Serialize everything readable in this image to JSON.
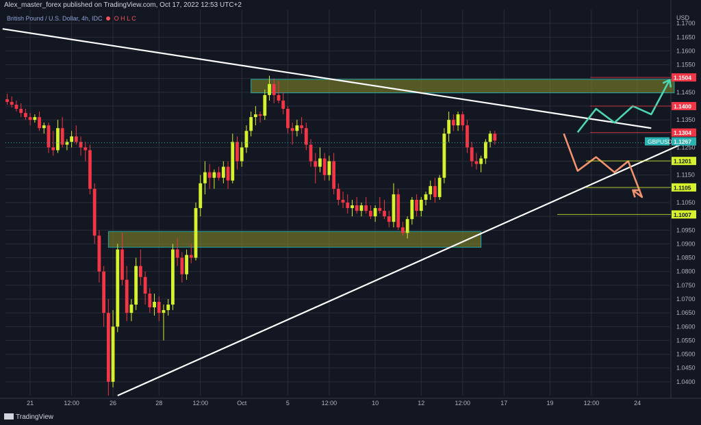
{
  "header": {
    "credit": "Alex_master_forex published on TradingView.com, Oct 17, 2022 12:53 UTC+2",
    "symbol": "British Pound / U.S. Dollar, 4h, IDC",
    "ohlc_hint": "O  H  L  C"
  },
  "footer": {
    "brand": "TradingView"
  },
  "chart_data": {
    "type": "candlestick",
    "symbol": "GBPUSD",
    "timeframe": "4h",
    "currency": "USD",
    "y_range": [
      1.035,
      1.175
    ],
    "y_ticks": [
      1.04,
      1.045,
      1.05,
      1.055,
      1.06,
      1.065,
      1.07,
      1.075,
      1.08,
      1.085,
      1.09,
      1.095,
      1.1,
      1.105,
      1.11,
      1.115,
      1.12,
      1.125,
      1.13,
      1.135,
      1.14,
      1.145,
      1.15,
      1.155,
      1.16,
      1.165,
      1.17
    ],
    "x_ticks": [
      {
        "label": "21",
        "bar": 5
      },
      {
        "label": "12:00",
        "bar": 14
      },
      {
        "label": "26",
        "bar": 23
      },
      {
        "label": "28",
        "bar": 33
      },
      {
        "label": "12:00",
        "bar": 42
      },
      {
        "label": "Oct",
        "bar": 51
      },
      {
        "label": "5",
        "bar": 61
      },
      {
        "label": "12:00",
        "bar": 70
      },
      {
        "label": "10",
        "bar": 80
      },
      {
        "label": "12",
        "bar": 90
      },
      {
        "label": "12:00",
        "bar": 99
      },
      {
        "label": "17",
        "bar": 108
      },
      {
        "label": "19",
        "bar": 118
      },
      {
        "label": "12:00",
        "bar": 127
      },
      {
        "label": "24",
        "bar": 137
      }
    ],
    "candles": [
      [
        1.1425,
        1.1445,
        1.1405,
        1.1415
      ],
      [
        1.1415,
        1.1435,
        1.1395,
        1.1405
      ],
      [
        1.1405,
        1.142,
        1.138,
        1.139
      ],
      [
        1.139,
        1.141,
        1.136,
        1.1375
      ],
      [
        1.1375,
        1.139,
        1.135,
        1.136
      ],
      [
        1.136,
        1.1375,
        1.133,
        1.135
      ],
      [
        1.135,
        1.137,
        1.134,
        1.136
      ],
      [
        1.136,
        1.138,
        1.131,
        1.132
      ],
      [
        1.132,
        1.134,
        1.13,
        1.133
      ],
      [
        1.133,
        1.134,
        1.123,
        1.125
      ],
      [
        1.125,
        1.131,
        1.122,
        1.124
      ],
      [
        1.124,
        1.135,
        1.123,
        1.132
      ],
      [
        1.132,
        1.136,
        1.125,
        1.126
      ],
      [
        1.126,
        1.128,
        1.124,
        1.127
      ],
      [
        1.127,
        1.131,
        1.125,
        1.129
      ],
      [
        1.129,
        1.133,
        1.126,
        1.127
      ],
      [
        1.127,
        1.129,
        1.122,
        1.125
      ],
      [
        1.125,
        1.127,
        1.12,
        1.124
      ],
      [
        1.124,
        1.126,
        1.108,
        1.11
      ],
      [
        1.11,
        1.112,
        1.09,
        1.093
      ],
      [
        1.093,
        1.095,
        1.076,
        1.08
      ],
      [
        1.08,
        1.082,
        1.06,
        1.065
      ],
      [
        1.065,
        1.07,
        1.035,
        1.04
      ],
      [
        1.04,
        1.066,
        1.038,
        1.06
      ],
      [
        1.06,
        1.09,
        1.058,
        1.088
      ],
      [
        1.088,
        1.094,
        1.075,
        1.077
      ],
      [
        1.077,
        1.082,
        1.062,
        1.065
      ],
      [
        1.065,
        1.07,
        1.062,
        1.068
      ],
      [
        1.068,
        1.085,
        1.066,
        1.082
      ],
      [
        1.082,
        1.088,
        1.075,
        1.078
      ],
      [
        1.078,
        1.08,
        1.068,
        1.072
      ],
      [
        1.072,
        1.074,
        1.065,
        1.067
      ],
      [
        1.067,
        1.072,
        1.064,
        1.069
      ],
      [
        1.069,
        1.071,
        1.062,
        1.065
      ],
      [
        1.065,
        1.068,
        1.055,
        1.066
      ],
      [
        1.066,
        1.07,
        1.064,
        1.068
      ],
      [
        1.068,
        1.09,
        1.066,
        1.088
      ],
      [
        1.088,
        1.092,
        1.082,
        1.085
      ],
      [
        1.085,
        1.087,
        1.076,
        1.079
      ],
      [
        1.079,
        1.088,
        1.077,
        1.086
      ],
      [
        1.086,
        1.09,
        1.083,
        1.085
      ],
      [
        1.085,
        1.105,
        1.084,
        1.103
      ],
      [
        1.103,
        1.115,
        1.1,
        1.112
      ],
      [
        1.112,
        1.12,
        1.108,
        1.116
      ],
      [
        1.116,
        1.119,
        1.11,
        1.114
      ],
      [
        1.114,
        1.117,
        1.11,
        1.116
      ],
      [
        1.116,
        1.118,
        1.113,
        1.114
      ],
      [
        1.114,
        1.12,
        1.112,
        1.118
      ],
      [
        1.118,
        1.12,
        1.11,
        1.113
      ],
      [
        1.113,
        1.13,
        1.112,
        1.127
      ],
      [
        1.127,
        1.129,
        1.117,
        1.12
      ],
      [
        1.12,
        1.127,
        1.118,
        1.125
      ],
      [
        1.125,
        1.133,
        1.123,
        1.131
      ],
      [
        1.131,
        1.138,
        1.129,
        1.136
      ],
      [
        1.136,
        1.14,
        1.133,
        1.137
      ],
      [
        1.137,
        1.138,
        1.134,
        1.1365
      ],
      [
        1.1365,
        1.146,
        1.135,
        1.144
      ],
      [
        1.144,
        1.151,
        1.142,
        1.148
      ],
      [
        1.148,
        1.15,
        1.141,
        1.144
      ],
      [
        1.144,
        1.149,
        1.141,
        1.142
      ],
      [
        1.142,
        1.145,
        1.137,
        1.139
      ],
      [
        1.139,
        1.14,
        1.13,
        1.132
      ],
      [
        1.132,
        1.134,
        1.126,
        1.131
      ],
      [
        1.131,
        1.135,
        1.129,
        1.133
      ],
      [
        1.133,
        1.136,
        1.13,
        1.132
      ],
      [
        1.132,
        1.134,
        1.124,
        1.126
      ],
      [
        1.126,
        1.128,
        1.118,
        1.12
      ],
      [
        1.12,
        1.123,
        1.112,
        1.118
      ],
      [
        1.118,
        1.125,
        1.116,
        1.121
      ],
      [
        1.121,
        1.123,
        1.113,
        1.115
      ],
      [
        1.115,
        1.122,
        1.113,
        1.12
      ],
      [
        1.12,
        1.123,
        1.108,
        1.11
      ],
      [
        1.11,
        1.112,
        1.104,
        1.106
      ],
      [
        1.106,
        1.109,
        1.103,
        1.105
      ],
      [
        1.105,
        1.108,
        1.101,
        1.103
      ],
      [
        1.103,
        1.106,
        1.1,
        1.104
      ],
      [
        1.104,
        1.107,
        1.101,
        1.102
      ],
      [
        1.102,
        1.105,
        1.1,
        1.104
      ],
      [
        1.104,
        1.107,
        1.101,
        1.102
      ],
      [
        1.102,
        1.104,
        1.099,
        1.1
      ],
      [
        1.1,
        1.104,
        1.098,
        1.103
      ],
      [
        1.103,
        1.107,
        1.101,
        1.102
      ],
      [
        1.102,
        1.106,
        1.099,
        1.1
      ],
      [
        1.1,
        1.102,
        1.096,
        1.098
      ],
      [
        1.098,
        1.112,
        1.096,
        1.108
      ],
      [
        1.108,
        1.11,
        1.095,
        1.096
      ],
      [
        1.096,
        1.098,
        1.093,
        1.094
      ],
      [
        1.094,
        1.1,
        1.092,
        1.099
      ],
      [
        1.099,
        1.107,
        1.097,
        1.106
      ],
      [
        1.106,
        1.108,
        1.1,
        1.102
      ],
      [
        1.102,
        1.107,
        1.1,
        1.106
      ],
      [
        1.106,
        1.109,
        1.104,
        1.108
      ],
      [
        1.108,
        1.113,
        1.106,
        1.111
      ],
      [
        1.111,
        1.114,
        1.105,
        1.107
      ],
      [
        1.107,
        1.115,
        1.106,
        1.114
      ],
      [
        1.114,
        1.132,
        1.112,
        1.13
      ],
      [
        1.13,
        1.138,
        1.127,
        1.135
      ],
      [
        1.135,
        1.137,
        1.131,
        1.133
      ],
      [
        1.133,
        1.138,
        1.131,
        1.137
      ],
      [
        1.137,
        1.138,
        1.131,
        1.133
      ],
      [
        1.133,
        1.135,
        1.123,
        1.125
      ],
      [
        1.125,
        1.127,
        1.118,
        1.12
      ],
      [
        1.12,
        1.123,
        1.117,
        1.119
      ],
      [
        1.119,
        1.122,
        1.116,
        1.121
      ],
      [
        1.121,
        1.128,
        1.119,
        1.127
      ],
      [
        1.127,
        1.131,
        1.125,
        1.13
      ],
      [
        1.13,
        1.131,
        1.126,
        1.1275
      ]
    ],
    "lines": [
      {
        "name": "upper-trendline",
        "from": [
          "bar:-1",
          1.168
        ],
        "to": [
          "bar:140",
          1.132
        ]
      },
      {
        "name": "lower-trendline",
        "from": [
          "bar:24",
          1.035
        ],
        "to": [
          "bar:147",
          1.1265
        ]
      }
    ],
    "zones": [
      {
        "name": "supply-zone",
        "from_bar": 53,
        "to_bar": 145,
        "top": 1.1497,
        "bottom": 1.1448
      },
      {
        "name": "demand-zone",
        "from_bar": 22,
        "to_bar": 103,
        "top": 1.0945,
        "bottom": 1.0888
      }
    ],
    "scenarios": [
      {
        "name": "bullish-path",
        "color": "#4dd7b0",
        "points": [
          [
            124,
            1.1305
          ],
          [
            128,
            1.139
          ],
          [
            132,
            1.134
          ],
          [
            136,
            1.14
          ],
          [
            140,
            1.137
          ],
          [
            144,
            1.1495
          ]
        ]
      },
      {
        "name": "bearish-path",
        "color": "#f2926e",
        "points": [
          [
            121,
            1.13
          ],
          [
            124,
            1.1165
          ],
          [
            128,
            1.1215
          ],
          [
            132,
            1.116
          ],
          [
            135,
            1.12
          ],
          [
            138,
            1.107
          ],
          [
            136,
            1.1095
          ]
        ]
      }
    ],
    "price_labels": [
      {
        "label": "1.1504",
        "value": 1.1504,
        "style": "red"
      },
      {
        "label": "1.1400",
        "value": 1.14,
        "style": "red"
      },
      {
        "label": "1.1304",
        "value": 1.1304,
        "style": "red"
      },
      {
        "label": "GBPUSD",
        "value": 1.1272,
        "style": "symbol"
      },
      {
        "label": "1.1267",
        "value": 1.1272,
        "style": "current"
      },
      {
        "label": "1.1201",
        "value": 1.1201,
        "style": "yellow"
      },
      {
        "label": "1.1105",
        "value": 1.1105,
        "style": "yellow"
      },
      {
        "label": "1.1007",
        "value": 1.1007,
        "style": "yellow"
      }
    ],
    "current_price": 1.1267,
    "colors": {
      "up": "#d6f22c",
      "down": "#f23645",
      "trend": "#ffffff",
      "zone_fill": "#8a8f2a",
      "zone_border": "#22a6a6",
      "grid": "#2a2e39",
      "bg": "#131722"
    }
  }
}
